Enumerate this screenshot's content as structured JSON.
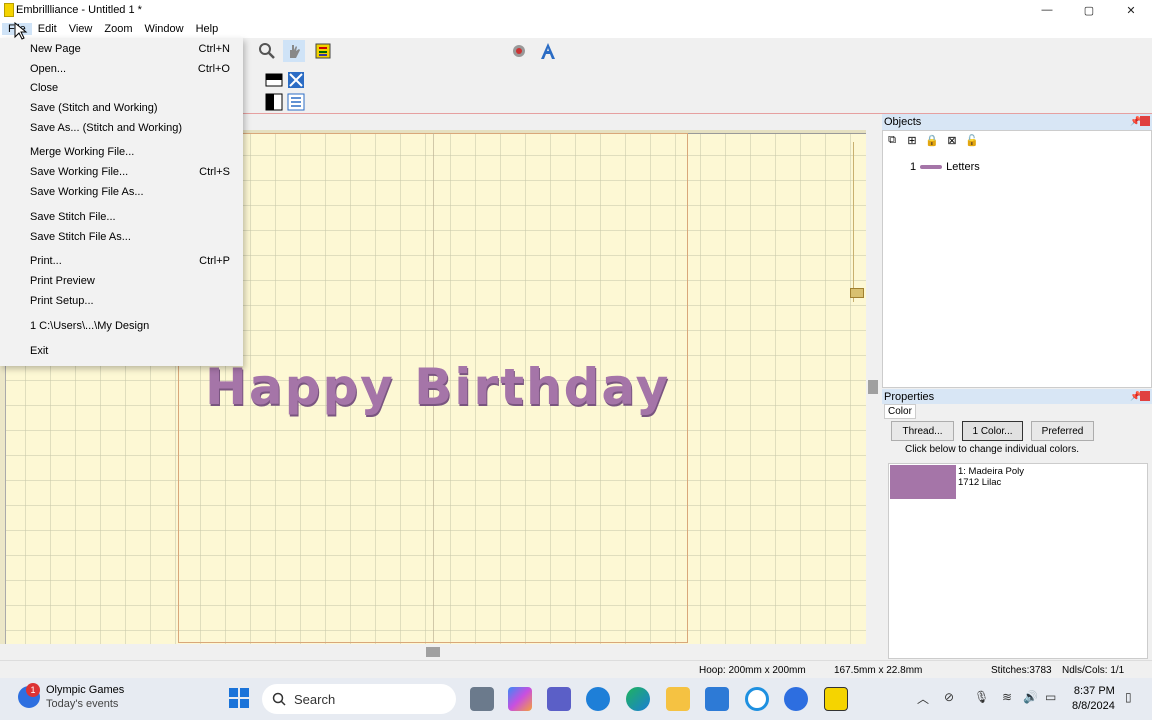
{
  "window": {
    "title": "Embrillliance -  Untitled 1 *",
    "minimize": "—",
    "maximize": "▢",
    "close": "✕"
  },
  "menubar": {
    "items": [
      "File",
      "Edit",
      "View",
      "Zoom",
      "Window",
      "Help"
    ]
  },
  "file_menu": {
    "items": [
      {
        "label": "New Page",
        "shortcut": "Ctrl+N"
      },
      {
        "label": "Open...",
        "shortcut": "Ctrl+O"
      },
      {
        "label": "Close",
        "shortcut": ""
      },
      {
        "label": "Save (Stitch and Working)",
        "shortcut": ""
      },
      {
        "label": "Save As... (Stitch and Working)",
        "shortcut": ""
      },
      {
        "label": "Merge Working File...",
        "shortcut": ""
      },
      {
        "label": "Save Working File...",
        "shortcut": "Ctrl+S"
      },
      {
        "label": "Save Working File As...",
        "shortcut": ""
      },
      {
        "label": "Save Stitch File...",
        "shortcut": ""
      },
      {
        "label": "Save Stitch File As...",
        "shortcut": ""
      },
      {
        "label": "Print...",
        "shortcut": "Ctrl+P"
      },
      {
        "label": "Print Preview",
        "shortcut": ""
      },
      {
        "label": "Print Setup...",
        "shortcut": ""
      },
      {
        "label": "1 C:\\Users\\...\\My Design",
        "shortcut": ""
      },
      {
        "label": "Exit",
        "shortcut": ""
      }
    ]
  },
  "canvas": {
    "design_text": "Happy Birthday",
    "design_color": "#a575a8"
  },
  "objects_panel": {
    "title": "Objects",
    "items": [
      {
        "index": "1",
        "name": "Letters"
      }
    ]
  },
  "properties_panel": {
    "title": "Properties",
    "tab": "Color",
    "buttons": [
      "Thread...",
      "1 Color...",
      "Preferred"
    ],
    "hint": "Click below to change individual colors.",
    "colors": [
      {
        "line1": "1: Madeira Poly",
        "line2": "1712 Lilac",
        "hex": "#a575a8"
      }
    ]
  },
  "statusbar": {
    "hoop": "Hoop: 200mm x 200mm",
    "size": "167.5mm x 22.8mm",
    "stitches": "Stitches:3783",
    "ndls": "Ndls/Cols: 1/1"
  },
  "taskbar": {
    "news_badge": "1",
    "news_title": "Olympic Games",
    "news_subtitle": "Today's events",
    "search_placeholder": "Search",
    "time": "8:37 PM",
    "date": "8/8/2024"
  }
}
